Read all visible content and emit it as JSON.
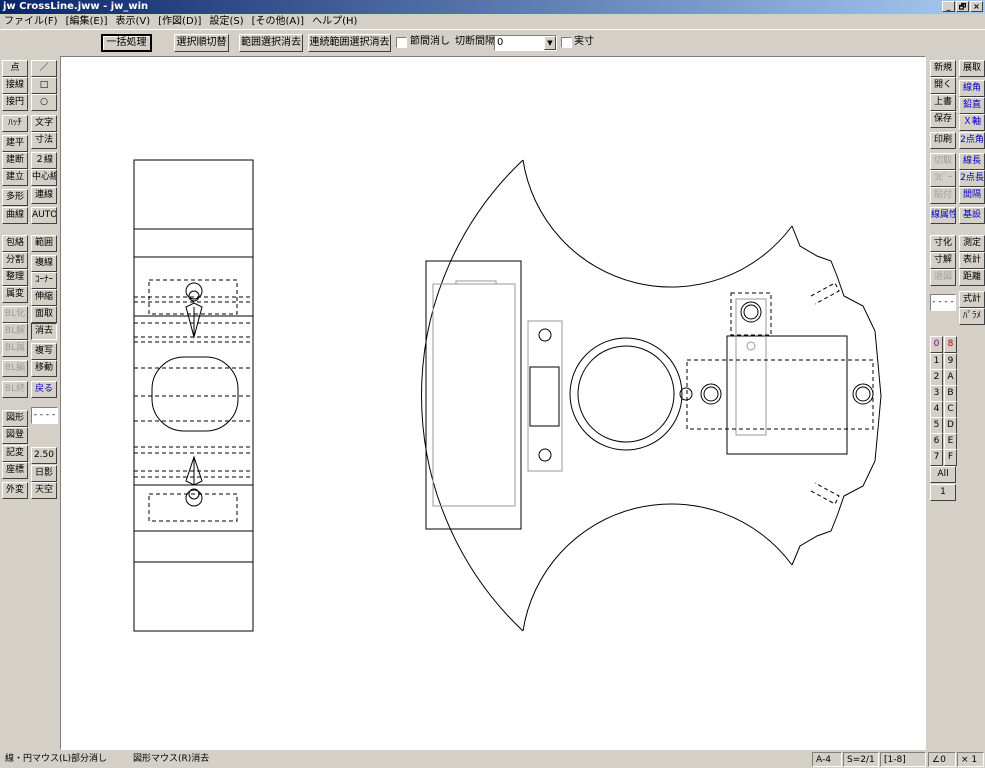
{
  "window": {
    "title": "jw CrossLine.jww - jw_win",
    "controls": [
      "_",
      "🗗",
      "×"
    ]
  },
  "menu": [
    "ファイル(F)",
    "[編集(E)]",
    "表示(V)",
    "[作図(D)]",
    "設定(S)",
    "[その他(A)]",
    "ヘルプ(H)"
  ],
  "toolbar": {
    "batch": "一括処理",
    "select_order": "選択順切替",
    "range_select_erase": "範囲選択消去",
    "continuous_range_erase": "連続範囲選択消去",
    "node_erase": "節間消し",
    "cut_interval_label": "切断間隔",
    "cut_interval_value": "0",
    "actual_size": "実寸"
  },
  "left_tools": {
    "col1": [
      "点",
      "接線",
      "接円",
      "ﾊｯﾁ",
      "建平",
      "建断",
      "建立",
      "多形",
      "曲線",
      "包絡",
      "分割",
      "整理",
      "属変",
      "BL化",
      "BL解",
      "BL属",
      "BL編",
      "BL終",
      "図形",
      "図登",
      "記変",
      "座標",
      "外変"
    ],
    "col2": [
      "／",
      "□",
      "○",
      "文字",
      "寸法",
      "２線",
      "中心線",
      "連線",
      "AUTO",
      "範囲",
      "複線",
      "ｺｰﾅｰ",
      "伸縮",
      "面取",
      "消去",
      "複写",
      "移動",
      "戻る",
      "- - - -",
      "2.50",
      "日影",
      "天空"
    ]
  },
  "right_tools": {
    "col1": [
      "新規",
      "開く",
      "上書",
      "保存",
      "印刷",
      "切取",
      "ｺﾋﾟｰ",
      "貼付",
      "線属性",
      "寸化",
      "寸解",
      "退図",
      "- - - -"
    ],
    "col2": [
      "展取",
      "線角",
      "鉛直",
      "Ｘ軸",
      "2点角",
      "線長",
      "2点長",
      "間隔",
      "基設",
      "測定",
      "表計",
      "距離",
      "式計",
      "ﾊﾟﾗﾒ"
    ],
    "layers_left": [
      "0",
      "1",
      "2",
      "3",
      "4",
      "5",
      "6",
      "7",
      "All",
      "1"
    ],
    "layers_right": [
      "8",
      "9",
      "A",
      "B",
      "C",
      "D",
      "E",
      "F",
      "×"
    ]
  },
  "status": {
    "message_left": "線・円マウス(L)部分消し",
    "message_right": "図形マウス(R)消去",
    "paper": "A-4",
    "scale": "S=2/1",
    "layer_range": "[1-8]",
    "angle": "∠0",
    "zoom": "× 1"
  }
}
